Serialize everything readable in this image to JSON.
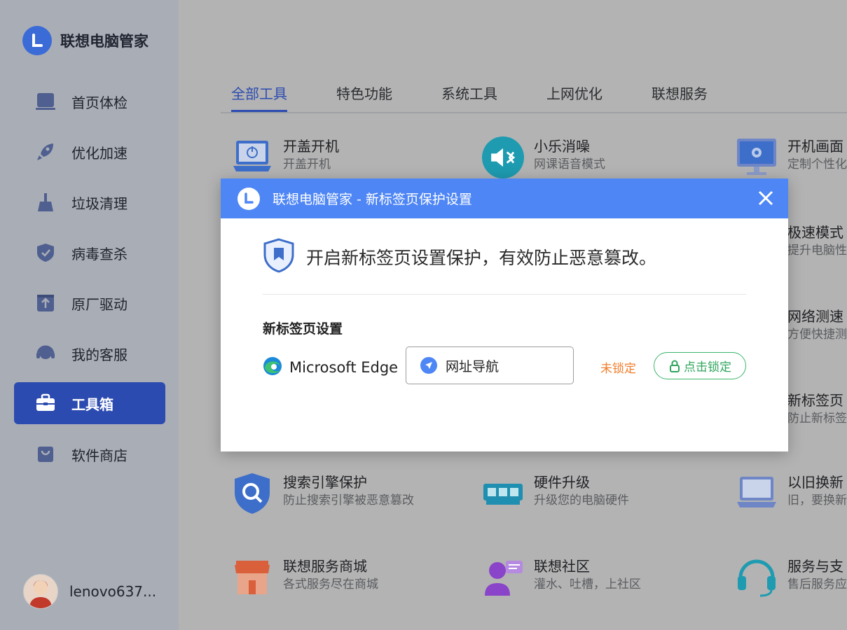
{
  "app": {
    "title": "联想电脑管家"
  },
  "sidebar": {
    "items": [
      {
        "label": "首页体检",
        "icon": "laptop-icon"
      },
      {
        "label": "优化加速",
        "icon": "rocket-icon"
      },
      {
        "label": "垃圾清理",
        "icon": "broom-icon"
      },
      {
        "label": "病毒查杀",
        "icon": "shield-icon"
      },
      {
        "label": "原厂驱动",
        "icon": "upload-box-icon"
      },
      {
        "label": "我的客服",
        "icon": "headset-icon"
      },
      {
        "label": "工具箱",
        "icon": "toolbox-icon",
        "active": true
      },
      {
        "label": "软件商店",
        "icon": "shopping-bag-icon"
      }
    ],
    "user": {
      "name": "lenovo637..."
    }
  },
  "tabs": [
    {
      "label": "全部工具",
      "active": true
    },
    {
      "label": "特色功能"
    },
    {
      "label": "系统工具"
    },
    {
      "label": "上网优化"
    },
    {
      "label": "联想服务"
    }
  ],
  "tools": [
    {
      "name": "开盖开机",
      "desc": "开盖开机",
      "icon": "laptop-power-icon"
    },
    {
      "name": "小乐消噪",
      "desc": "网课语音模式",
      "icon": "speaker-mute-icon"
    },
    {
      "name": "开机画面",
      "desc": "定制个性化",
      "icon": "monitor-flower-icon"
    },
    {
      "name": "极速模式",
      "desc": "提升电脑性"
    },
    {
      "name": "网络测速",
      "desc": "方便快捷测"
    },
    {
      "name": "新标签页",
      "desc": "防止新标签"
    },
    {
      "name": "搜索引擎保护",
      "desc": "防止搜索引擎被恶意篡改",
      "icon": "search-shield-icon"
    },
    {
      "name": "硬件升级",
      "desc": "升级您的电脑硬件",
      "icon": "memory-chip-icon"
    },
    {
      "name": "以旧换新",
      "desc": "旧，要换新",
      "icon": "laptop-icon"
    },
    {
      "name": "联想服务商城",
      "desc": "各式服务尽在商城",
      "icon": "store-icon"
    },
    {
      "name": "联想社区",
      "desc": "灌水、吐槽，上社区",
      "icon": "community-icon"
    },
    {
      "name": "服务与支",
      "desc": "售后服务应",
      "icon": "headset-icon"
    }
  ],
  "modal": {
    "title": "联想电脑管家 - 新标签页保护设置",
    "headline": "开启新标签页设置保护，有效防止恶意篡改。",
    "section_label": "新标签页设置",
    "browser": "Microsoft Edge",
    "select_value": "网址导航",
    "status": "未锁定",
    "lock_button": "点击锁定",
    "colors": {
      "header": "#4e86f5",
      "status": "#f07d2b",
      "lock": "#2fa55e"
    }
  }
}
